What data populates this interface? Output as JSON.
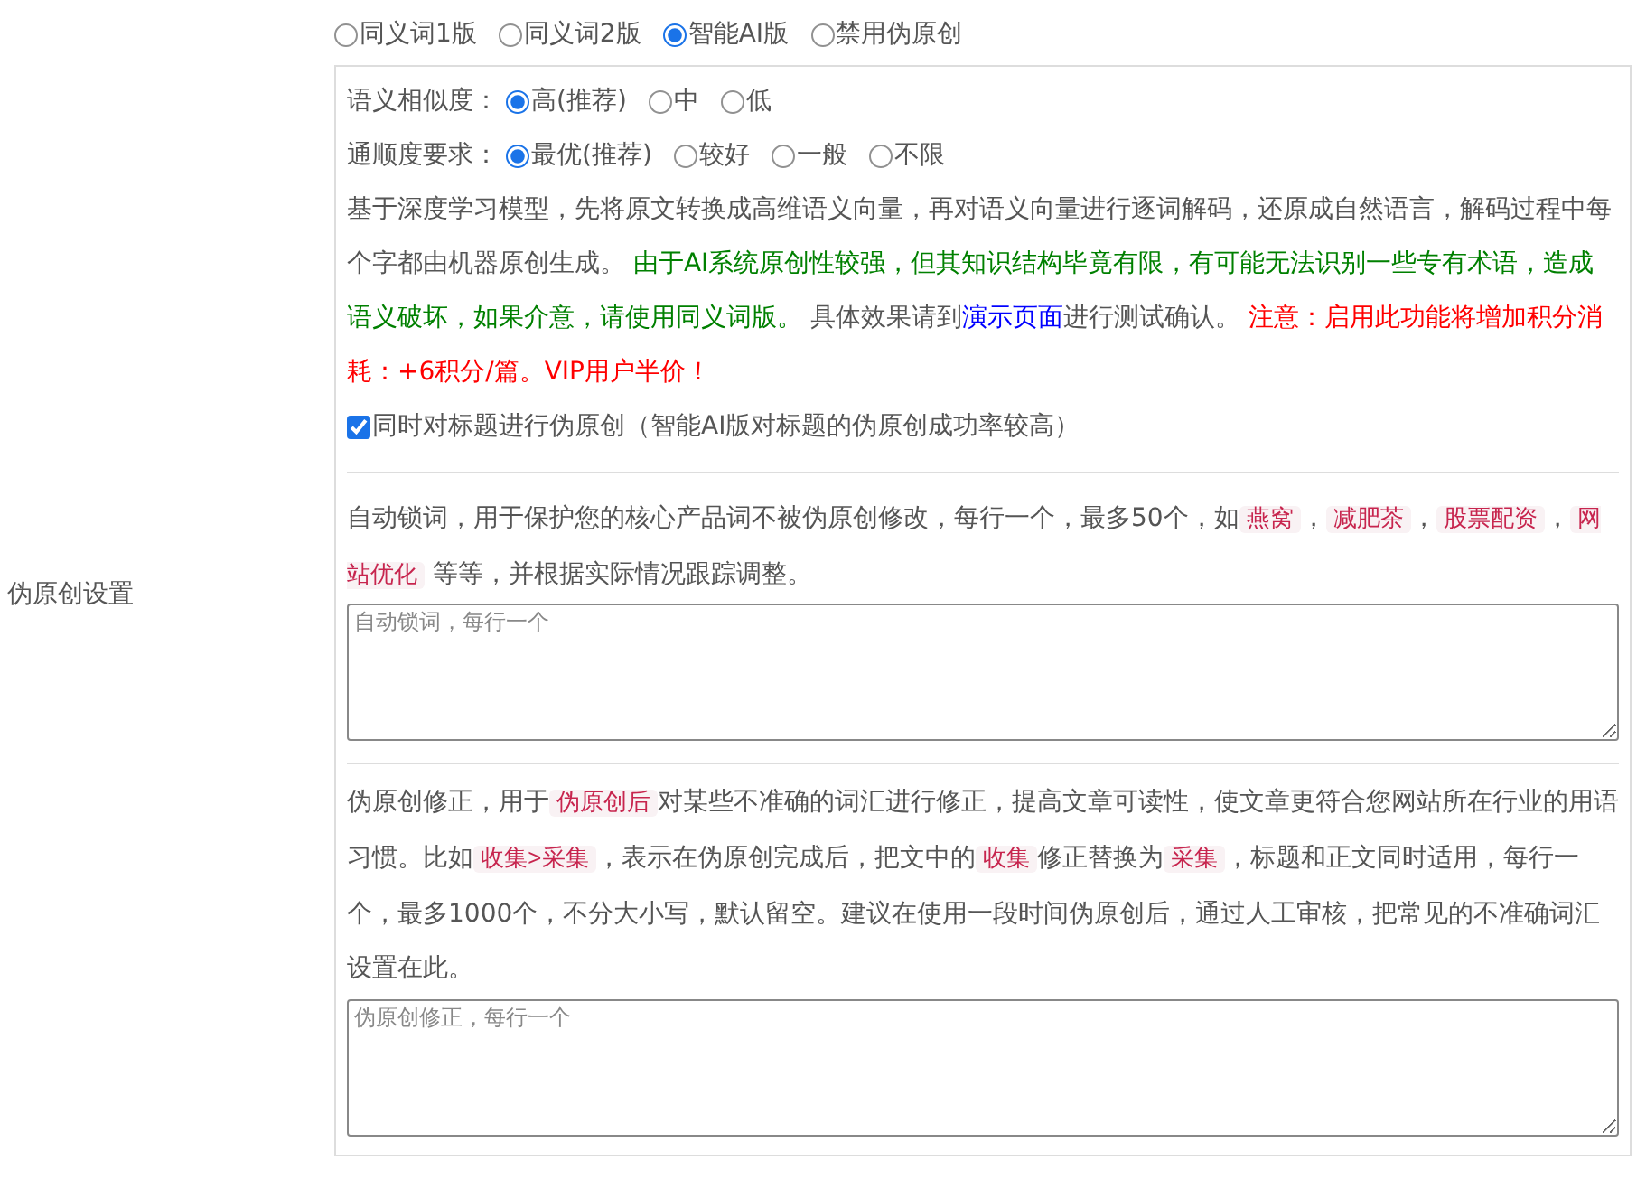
{
  "label": "伪原创设置",
  "modes": [
    {
      "label": "同义词1版",
      "selected": false
    },
    {
      "label": "同义词2版",
      "selected": false
    },
    {
      "label": "智能AI版",
      "selected": true
    },
    {
      "label": "禁用伪原创",
      "selected": false
    }
  ],
  "similarity": {
    "label": "语义相似度：",
    "options": [
      {
        "label": "高(推荐)",
        "selected": true
      },
      {
        "label": "中",
        "selected": false
      },
      {
        "label": "低",
        "selected": false
      }
    ]
  },
  "fluency": {
    "label": "通顺度要求：",
    "options": [
      {
        "label": "最优(推荐)",
        "selected": true
      },
      {
        "label": "较好",
        "selected": false
      },
      {
        "label": "一般",
        "selected": false
      },
      {
        "label": "不限",
        "selected": false
      }
    ]
  },
  "description": [
    {
      "kind": "plain",
      "text": "基于深度学习模型，先将原文转换成高维语义向量，再对语义向量进行逐词解码，还原成自然语言，解码过程中每个字都由机器原创生成。 "
    },
    {
      "kind": "green",
      "text": "由于AI系统原创性较强，但其知识结构毕竟有限，有可能无法识别一些专有术语，造成语义破坏，如果介意，请使用同义词版。"
    },
    {
      "kind": "plain",
      "text": " 具体效果请到"
    },
    {
      "kind": "link",
      "text": "演示页面"
    },
    {
      "kind": "plain",
      "text": "进行测试确认。 "
    },
    {
      "kind": "red",
      "text": "注意：启用此功能将增加积分消耗：+6积分/篇。VIP用户半价！"
    }
  ],
  "title_option": {
    "label": "同时对标题进行伪原创（智能AI版对标题的伪原创成功率较高）",
    "checked": true
  },
  "lock_words": {
    "description": [
      {
        "kind": "plain",
        "text": "自动锁词，用于保护您的核心产品词不被伪原创修改，每行一个，最多50个，如"
      },
      {
        "kind": "code",
        "text": "燕窝"
      },
      {
        "kind": "plain",
        "text": "，"
      },
      {
        "kind": "code",
        "text": "减肥茶"
      },
      {
        "kind": "plain",
        "text": "，"
      },
      {
        "kind": "code",
        "text": "股票配资"
      },
      {
        "kind": "plain",
        "text": "，"
      },
      {
        "kind": "code",
        "text": "网站优化"
      },
      {
        "kind": "plain",
        "text": " 等等，并根据实际情况跟踪调整。"
      }
    ],
    "placeholder": "自动锁词，每行一个"
  },
  "corrections": {
    "description": [
      {
        "kind": "plain",
        "text": "伪原创修正，用于"
      },
      {
        "kind": "code",
        "text": "伪原创后"
      },
      {
        "kind": "plain",
        "text": "对某些不准确的词汇进行修正，提高文章可读性，使文章更符合您网站所在行业的用语习惯。比如"
      },
      {
        "kind": "code",
        "text": "收集>采集"
      },
      {
        "kind": "plain",
        "text": "，表示在伪原创完成后，把文中的"
      },
      {
        "kind": "code",
        "text": "收集"
      },
      {
        "kind": "plain",
        "text": "修正替换为"
      },
      {
        "kind": "code",
        "text": "采集"
      },
      {
        "kind": "plain",
        "text": "，标题和正文同时适用，每行一个，最多1000个，不分大小写，默认留空。建议在使用一段时间伪原创后，通过人工审核，把常见的不准确词汇设置在此。"
      }
    ],
    "placeholder": "伪原创修正，每行一个"
  }
}
